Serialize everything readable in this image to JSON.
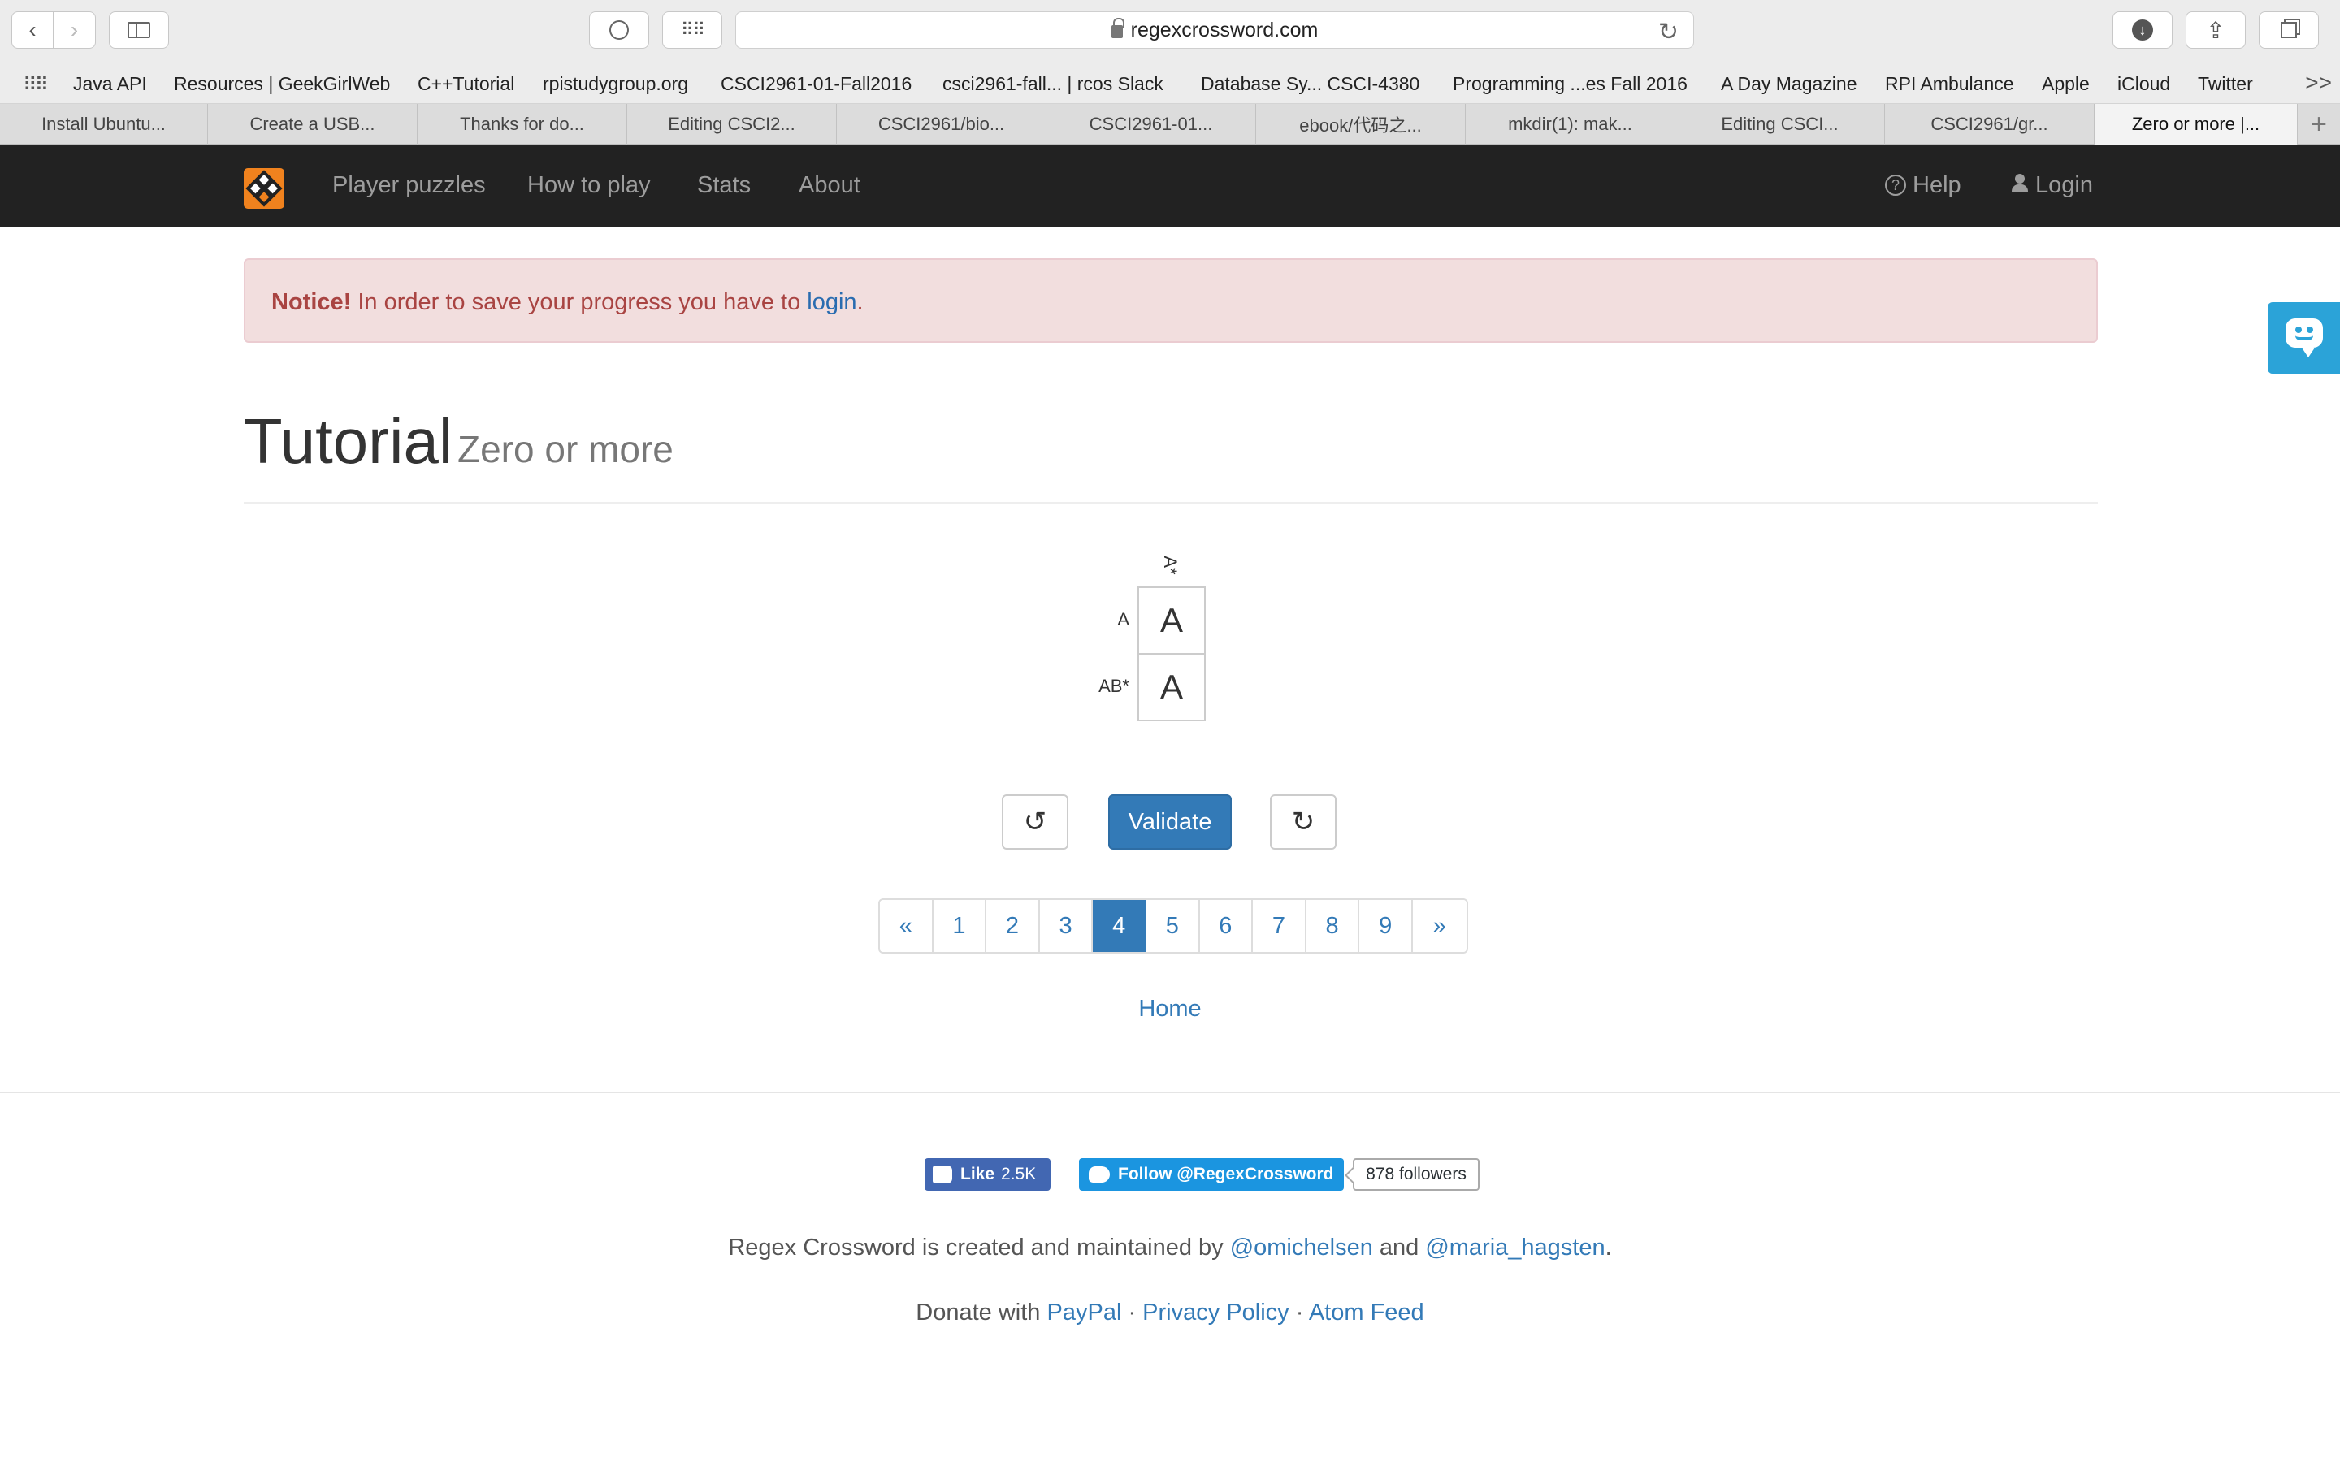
{
  "browser": {
    "url": "regexcrossword.com",
    "bookmarks": [
      "Java API",
      "Resources | GeekGirlWeb",
      "C++Tutorial",
      "rpistudygroup.org",
      "CSCI2961-01-Fall2016",
      "csci2961-fall... | rcos Slack",
      "Database Sy... CSCI-4380",
      "Programming ...es Fall 2016",
      "A Day Magazine",
      "RPI Ambulance",
      "Apple",
      "iCloud",
      "Twitter"
    ],
    "more": ">>",
    "tabs": [
      "Install Ubuntu...",
      "Create a USB...",
      "Thanks for do...",
      "Editing CSCI2...",
      "CSCI2961/bio...",
      "CSCI2961-01...",
      "ebook/代码之...",
      "mkdir(1): mak...",
      "Editing CSCI...",
      "CSCI2961/gr...",
      "Zero or more |..."
    ],
    "new_tab": "+"
  },
  "navbar": {
    "links": [
      "Player puzzles",
      "How to play",
      "Stats",
      "About"
    ],
    "help": "Help",
    "login": "Login"
  },
  "notice": {
    "strong": "Notice!",
    "text": " In order to save your progress you have to ",
    "link": "login",
    "end": "."
  },
  "header": {
    "title": "Tutorial",
    "subtitle": "Zero or more"
  },
  "puzzle": {
    "column_clue": "A*",
    "rows": [
      {
        "clue": "A",
        "value": "A"
      },
      {
        "clue": "AB*",
        "value": "A"
      }
    ]
  },
  "controls": {
    "undo": "↺",
    "validate": "Validate",
    "redo": "↻"
  },
  "pagination": {
    "prev": "«",
    "pages": [
      "1",
      "2",
      "3",
      "4",
      "5",
      "6",
      "7",
      "8",
      "9"
    ],
    "next": "»",
    "current": "4"
  },
  "home": "Home",
  "footer": {
    "like_label": "Like",
    "like_count": "2.5K",
    "follow": "Follow @RegexCrossword",
    "followers": "878 followers",
    "credits_text": "Regex Crossword is created and maintained by ",
    "author1": "@omichelsen",
    "and": " and ",
    "author2": "@maria_hagsten",
    "period": ".",
    "donate_text": "Donate with ",
    "paypal": "PayPal",
    "sep": " · ",
    "privacy": "Privacy Policy",
    "atom": "Atom Feed"
  },
  "colors": {
    "navbar": "#222222",
    "primary": "#337ab7",
    "notice_bg": "#f2dede",
    "notice_text": "#a94442",
    "logo": "#f0821e"
  }
}
